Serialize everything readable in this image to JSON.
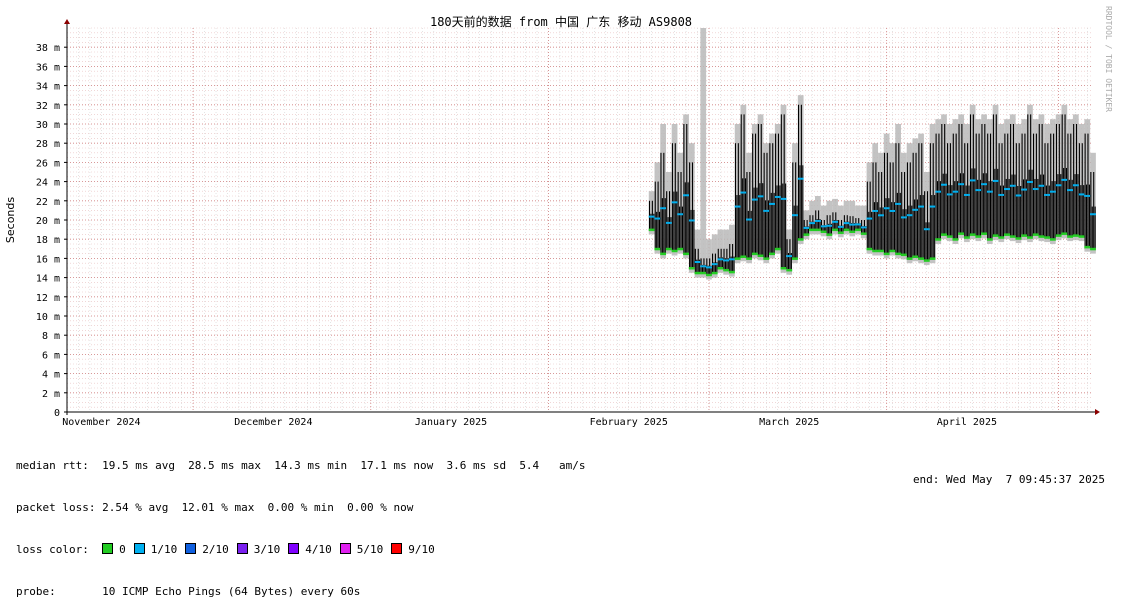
{
  "colors": {
    "grid_minor": "#e8c0c0",
    "grid_major": "#d08080",
    "grid_vertical": "#c8c8c8",
    "axis": "#000000",
    "arrow": "#8b0000",
    "smoke": "#b8b8b8",
    "median_line": "#000000",
    "median_green": "#22cc22",
    "median_cyan": "#00b0f0"
  },
  "chart_data": {
    "type": "area",
    "title": "180天前的数据 from 中国 广东 移动 AS9808",
    "ylabel": "Seconds",
    "ylim": [
      0,
      40
    ],
    "yticks": [
      {
        "value": 0,
        "label": "0"
      },
      {
        "value": 2,
        "label": "2 m"
      },
      {
        "value": 4,
        "label": "4 m"
      },
      {
        "value": 6,
        "label": "6 m"
      },
      {
        "value": 8,
        "label": "8 m"
      },
      {
        "value": 10,
        "label": "10 m"
      },
      {
        "value": 12,
        "label": "12 m"
      },
      {
        "value": 14,
        "label": "14 m"
      },
      {
        "value": 16,
        "label": "16 m"
      },
      {
        "value": 18,
        "label": "18 m"
      },
      {
        "value": 20,
        "label": "20 m"
      },
      {
        "value": 22,
        "label": "22 m"
      },
      {
        "value": 24,
        "label": "24 m"
      },
      {
        "value": 26,
        "label": "26 m"
      },
      {
        "value": 28,
        "label": "28 m"
      },
      {
        "value": 30,
        "label": "30 m"
      },
      {
        "value": 32,
        "label": "32 m"
      },
      {
        "value": 34,
        "label": "34 m"
      },
      {
        "value": 36,
        "label": "36 m"
      },
      {
        "value": 38,
        "label": "38 m"
      }
    ],
    "xlim": [
      "2024-11-09",
      "2025-05-07"
    ],
    "xticks": [
      {
        "date": "2024-11-15",
        "label": "November 2024"
      },
      {
        "date": "2024-12-15",
        "label": "December 2024"
      },
      {
        "date": "2025-01-15",
        "label": "January 2025"
      },
      {
        "date": "2025-02-15",
        "label": "February 2025"
      },
      {
        "date": "2025-03-15",
        "label": "March 2025"
      },
      {
        "date": "2025-04-15",
        "label": "April 2025"
      }
    ],
    "month_starts": [
      "2024-12-01",
      "2025-01-01",
      "2025-02-01",
      "2025-03-01",
      "2025-04-01",
      "2025-05-01"
    ],
    "grid": true,
    "series": [
      {
        "x": [
          "2025-02-19",
          "2025-02-20",
          "2025-02-21",
          "2025-02-22",
          "2025-02-23",
          "2025-02-24",
          "2025-02-25",
          "2025-02-26",
          "2025-02-27",
          "2025-02-28",
          "2025-03-01",
          "2025-03-02",
          "2025-03-03",
          "2025-03-04",
          "2025-03-05",
          "2025-03-06",
          "2025-03-07",
          "2025-03-08",
          "2025-03-09",
          "2025-03-10",
          "2025-03-11",
          "2025-03-12",
          "2025-03-13",
          "2025-03-14",
          "2025-03-15",
          "2025-03-16",
          "2025-03-17",
          "2025-03-18",
          "2025-03-19",
          "2025-03-20",
          "2025-03-21",
          "2025-03-22",
          "2025-03-23",
          "2025-03-24",
          "2025-03-25",
          "2025-03-26",
          "2025-03-27",
          "2025-03-28",
          "2025-03-29",
          "2025-03-30",
          "2025-03-31",
          "2025-04-01",
          "2025-04-02",
          "2025-04-03",
          "2025-04-04",
          "2025-04-05",
          "2025-04-06",
          "2025-04-07",
          "2025-04-08",
          "2025-04-09",
          "2025-04-10",
          "2025-04-11",
          "2025-04-12",
          "2025-04-13",
          "2025-04-14",
          "2025-04-15",
          "2025-04-16",
          "2025-04-17",
          "2025-04-18",
          "2025-04-19",
          "2025-04-20",
          "2025-04-21",
          "2025-04-22",
          "2025-04-23",
          "2025-04-24",
          "2025-04-25",
          "2025-04-26",
          "2025-04-27",
          "2025-04-28",
          "2025-04-29",
          "2025-04-30",
          "2025-05-01",
          "2025-05-02",
          "2025-05-03",
          "2025-05-04",
          "2025-05-05",
          "2025-05-06",
          "2025-05-07"
        ],
        "median_low": [
          19,
          17,
          16.5,
          17,
          16.8,
          17,
          16.5,
          15,
          14.5,
          14.5,
          14.3,
          14.5,
          15,
          14.8,
          14.6,
          16,
          16.2,
          16,
          16.5,
          16.3,
          16,
          16.5,
          17,
          15,
          14.8,
          16,
          18,
          18.5,
          19,
          19,
          18.8,
          18.5,
          19,
          18.7,
          19,
          18.8,
          19,
          18.6,
          17,
          16.8,
          16.8,
          16.5,
          16.8,
          16.5,
          16.4,
          16,
          16.2,
          16,
          15.8,
          16,
          18,
          18.5,
          18.3,
          18,
          18.6,
          18.2,
          18.5,
          18.3,
          18.6,
          18,
          18.4,
          18.2,
          18.5,
          18.3,
          18.1,
          18.4,
          18.2,
          18.5,
          18.3,
          18.2,
          18,
          18.4,
          18.6,
          18.3,
          18.4,
          18.3,
          17.2,
          17
        ],
        "median_high": [
          22,
          24,
          27,
          23,
          28,
          25,
          30,
          26,
          17,
          16,
          16,
          16.5,
          17,
          17,
          17.5,
          28,
          31,
          25,
          29,
          30,
          27,
          28,
          29,
          31,
          18,
          26,
          32,
          20,
          20.5,
          21,
          20,
          20.5,
          20.8,
          20,
          20.5,
          20.4,
          20.2,
          20,
          24,
          26,
          25,
          27,
          26,
          28,
          25,
          26,
          27,
          28,
          23,
          28,
          29,
          30,
          28,
          29,
          30,
          28,
          31,
          29,
          30,
          29,
          31,
          28,
          29,
          30,
          28,
          29,
          31,
          29,
          30,
          28,
          29,
          30,
          31,
          29,
          30,
          28,
          29,
          25
        ],
        "smoke_max": [
          23,
          26,
          30,
          25,
          30,
          27,
          31,
          28,
          19,
          40,
          18,
          18.5,
          19,
          19,
          19.5,
          30,
          32,
          27,
          30,
          31,
          28,
          29,
          30,
          32,
          19,
          28,
          33,
          21,
          22,
          22.5,
          21.5,
          22,
          22.2,
          21.5,
          22,
          22,
          21.5,
          21.5,
          26,
          28,
          27,
          29,
          28,
          30,
          27,
          28,
          28.5,
          29,
          25,
          30,
          30.5,
          31,
          30,
          30.5,
          31,
          30,
          32,
          30.5,
          31,
          30.5,
          32,
          30,
          30.5,
          31,
          30,
          30.5,
          32,
          30.5,
          31,
          30,
          30.5,
          31,
          32,
          30.5,
          31,
          30,
          30.5,
          27
        ],
        "smoke_min": [
          18.5,
          16.5,
          16,
          16.5,
          16.3,
          16.5,
          16,
          14.5,
          14,
          14,
          13.8,
          14,
          14.5,
          14.3,
          14.1,
          15.5,
          15.7,
          15.5,
          16,
          15.8,
          15.5,
          16,
          16.5,
          14.5,
          14.3,
          15.5,
          17.5,
          18,
          18.5,
          18.5,
          18.3,
          18,
          18.5,
          18.2,
          18.5,
          18.3,
          18.5,
          18.1,
          16.5,
          16.3,
          16.3,
          16,
          16.3,
          16,
          15.9,
          15.5,
          15.7,
          15.5,
          15.3,
          15.5,
          17.5,
          18,
          17.8,
          17.5,
          18.1,
          17.7,
          18,
          17.8,
          18.1,
          17.5,
          17.9,
          17.7,
          18,
          17.8,
          17.6,
          17.9,
          17.7,
          18,
          17.8,
          17.7,
          17.5,
          17.9,
          18.1,
          17.8,
          17.9,
          17.8,
          16.7,
          16.5
        ]
      }
    ]
  },
  "stats": {
    "median_rtt": "median rtt:  19.5 ms avg  28.5 ms max  14.3 ms min  17.1 ms now  3.6 ms sd  5.4   am/s",
    "packet_loss": "packet loss: 2.54 % avg  12.01 % max  0.00 % min  0.00 % now",
    "loss_color_label": "loss color:",
    "probe": "probe:       10 ICMP Echo Pings (64 Bytes) every 60s",
    "end": "end: Wed May  7 09:45:37 2025",
    "watermark": "RRDTOOL / TOBI OETIKER"
  },
  "loss_colors": [
    {
      "label": "0",
      "color": "#22cc22"
    },
    {
      "label": "1/10",
      "color": "#00b0f0"
    },
    {
      "label": "2/10",
      "color": "#1060e0"
    },
    {
      "label": "3/10",
      "color": "#7a20f0"
    },
    {
      "label": "4/10",
      "color": "#8000ff"
    },
    {
      "label": "5/10",
      "color": "#e020f0"
    },
    {
      "label": "9/10",
      "color": "#ff0000"
    }
  ]
}
